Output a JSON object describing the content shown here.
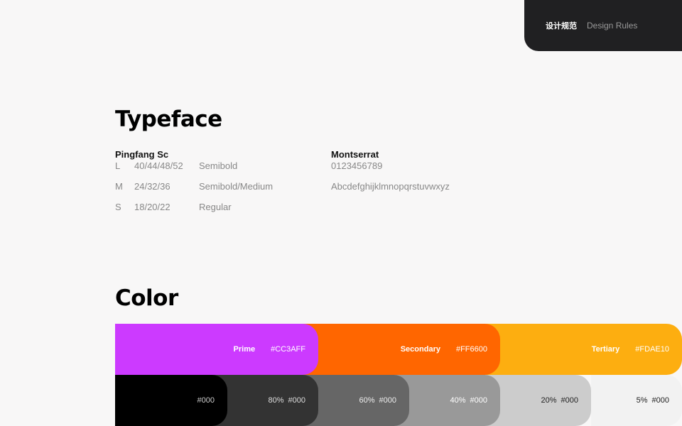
{
  "header": {
    "zh_label": "设计规范",
    "en_label": "Design Rules"
  },
  "typeface": {
    "title": "Typeface",
    "left": {
      "name": "Pingfang Sc",
      "rows": [
        {
          "size": "L",
          "values": "40/44/48/52",
          "weight": "Semibold"
        },
        {
          "size": "M",
          "values": "24/32/36",
          "weight": "Semibold/Medium"
        },
        {
          "size": "S",
          "values": "18/20/22",
          "weight": "Regular"
        }
      ]
    },
    "right": {
      "name": "Montserrat",
      "samples": [
        "0123456789",
        "Abcdefghijklmnopqrstuvwxyz"
      ]
    }
  },
  "color": {
    "title": "Color",
    "primary": [
      {
        "name": "Prime",
        "hex": "#CC3AFF",
        "color": "#cc3aff",
        "text_color": "#ffffff"
      },
      {
        "name": "Secondary",
        "hex": "#FF6600",
        "color": "#ff6600",
        "text_color": "#ffffff"
      },
      {
        "name": "Tertiary",
        "hex": "#FDAE10",
        "color": "#fdae10",
        "text_color": "#ffffff"
      }
    ],
    "grays": [
      {
        "percent": "",
        "hex": "#000",
        "color": "#000000",
        "text_color": "#cccccc"
      },
      {
        "percent": "80%",
        "hex": "#000",
        "color": "#333333",
        "text_color": "#dddddd"
      },
      {
        "percent": "60%",
        "hex": "#000",
        "color": "#666666",
        "text_color": "#eeeeee"
      },
      {
        "percent": "40%",
        "hex": "#000",
        "color": "#999999",
        "text_color": "#ffffff"
      },
      {
        "percent": "20%",
        "hex": "#000",
        "color": "#cccccc",
        "text_color": "#222222"
      },
      {
        "percent": "5%",
        "hex": "#000",
        "color": "#f2f2f2",
        "text_color": "#222222"
      }
    ]
  }
}
